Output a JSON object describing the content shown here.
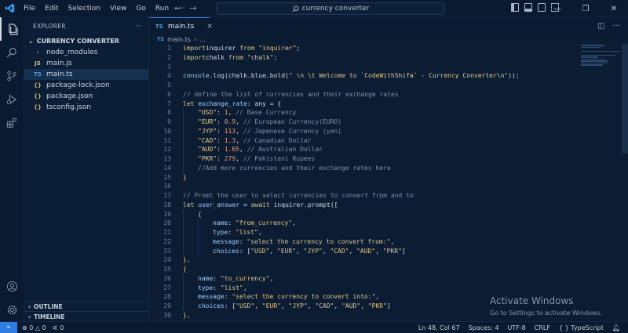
{
  "menu": [
    "File",
    "Edit",
    "Selection",
    "View",
    "Go",
    "Run",
    "···"
  ],
  "search": {
    "text": "currency converter"
  },
  "sidebar": {
    "title": "EXPLORER",
    "more": "···",
    "folder": "CURRENCY CONVERTER",
    "items": [
      {
        "label": "node_modules",
        "icon": "›",
        "icon_name": "folder-chevron-icon"
      },
      {
        "label": "main.js",
        "icon": "JS",
        "icon_name": "javascript-file-icon"
      },
      {
        "label": "main.ts",
        "icon": "TS",
        "icon_name": "typescript-file-icon"
      },
      {
        "label": "package-lock.json",
        "icon": "{}",
        "icon_name": "json-file-icon"
      },
      {
        "label": "package.json",
        "icon": "{}",
        "icon_name": "json-file-icon"
      },
      {
        "label": "tsconfig.json",
        "icon": "{}",
        "icon_name": "json-file-icon"
      }
    ],
    "outline": "OUTLINE",
    "timeline": "TIMELINE"
  },
  "tab": {
    "badge": "TS",
    "label": "main.ts",
    "close": "×"
  },
  "breadcrumb": {
    "badge": "TS",
    "file": "main.ts",
    "sep": "›",
    "rest": "..."
  },
  "code": [
    {
      "n": "1",
      "indent": 0,
      "t": [
        [
          "kw",
          "import"
        ],
        [
          "",
          "inquirer "
        ],
        [
          "kw",
          "from"
        ],
        [
          "str",
          " \"inquirer\""
        ],
        [
          "",
          ";"
        ]
      ]
    },
    {
      "n": "2",
      "indent": 0,
      "t": [
        [
          "kw",
          "import"
        ],
        [
          "",
          "chalk "
        ],
        [
          "kw",
          "from"
        ],
        [
          "str",
          " \"chalk\""
        ],
        [
          "",
          ";"
        ]
      ]
    },
    {
      "n": "3",
      "indent": 0,
      "t": []
    },
    {
      "n": "4",
      "indent": 0,
      "t": [
        [
          "id",
          "console"
        ],
        [
          "",
          ".log(chalk.blue.bold("
        ],
        [
          "str",
          "\" \\n \\t Welcome to `CodeWithShifa` - Currency Converter\\n\""
        ],
        [
          "",
          "));"
        ]
      ]
    },
    {
      "n": "5",
      "indent": 0,
      "t": []
    },
    {
      "n": "6",
      "indent": 0,
      "t": [
        [
          "cm",
          "// define the list of currencies and their exchange rates"
        ]
      ]
    },
    {
      "n": "7",
      "indent": 0,
      "t": [
        [
          "kw",
          "let"
        ],
        [
          "id",
          " exchange_rate"
        ],
        [
          "",
          ": any = {"
        ]
      ]
    },
    {
      "n": "8",
      "indent": 1,
      "t": [
        [
          "str",
          "\"USD\""
        ],
        [
          "",
          ": "
        ],
        [
          "num",
          "1"
        ],
        [
          "",
          ", "
        ],
        [
          "cm",
          "// Base Currency"
        ]
      ]
    },
    {
      "n": "9",
      "indent": 1,
      "t": [
        [
          "str",
          "\"EUR\""
        ],
        [
          "",
          ": "
        ],
        [
          "num",
          "0.9"
        ],
        [
          "",
          ", "
        ],
        [
          "cm",
          "// European Currency(EURO)"
        ]
      ]
    },
    {
      "n": "10",
      "indent": 1,
      "t": [
        [
          "str",
          "\"JYP\""
        ],
        [
          "",
          ": "
        ],
        [
          "num",
          "113"
        ],
        [
          "",
          ", "
        ],
        [
          "cm",
          "// Japenese Currency (yen)"
        ]
      ]
    },
    {
      "n": "11",
      "indent": 1,
      "t": [
        [
          "str",
          "\"CAD\""
        ],
        [
          "",
          ": "
        ],
        [
          "num",
          "1.3"
        ],
        [
          "",
          ", "
        ],
        [
          "cm",
          "// Canadian Dollar"
        ]
      ]
    },
    {
      "n": "12",
      "indent": 1,
      "t": [
        [
          "str",
          "\"AUD\""
        ],
        [
          "",
          ": "
        ],
        [
          "num",
          "1.65"
        ],
        [
          "",
          ", "
        ],
        [
          "cm",
          "// Australian Dollar"
        ]
      ]
    },
    {
      "n": "13",
      "indent": 1,
      "t": [
        [
          "str",
          "\"PKR\""
        ],
        [
          "",
          ": "
        ],
        [
          "num",
          "279"
        ],
        [
          "",
          ", "
        ],
        [
          "cm",
          "// Pakistani Rupees"
        ]
      ]
    },
    {
      "n": "14",
      "indent": 1,
      "t": [
        [
          "cm",
          "//Add more currencies and their exchange rates here"
        ]
      ]
    },
    {
      "n": "15",
      "indent": 0,
      "t": [
        [
          "kw",
          "}"
        ]
      ]
    },
    {
      "n": "16",
      "indent": 0,
      "t": []
    },
    {
      "n": "17",
      "indent": 0,
      "t": [
        [
          "cm",
          "// Promt the user to select currencies to convert frpm and to"
        ]
      ]
    },
    {
      "n": "18",
      "indent": 0,
      "t": [
        [
          "kw",
          "let"
        ],
        [
          "id",
          " user_answer"
        ],
        [
          "",
          " = "
        ],
        [
          "kw",
          "await"
        ],
        [
          "",
          " inquirer.prompt(["
        ]
      ]
    },
    {
      "n": "19",
      "indent": 1,
      "t": [
        [
          "kw",
          "{"
        ]
      ]
    },
    {
      "n": "20",
      "indent": 2,
      "t": [
        [
          "id",
          "name"
        ],
        [
          "",
          ": "
        ],
        [
          "str",
          "\"from_currency\""
        ],
        [
          "",
          ","
        ]
      ]
    },
    {
      "n": "21",
      "indent": 2,
      "t": [
        [
          "id",
          "type"
        ],
        [
          "",
          ": "
        ],
        [
          "str",
          "\"list\""
        ],
        [
          "",
          ","
        ]
      ]
    },
    {
      "n": "22",
      "indent": 2,
      "t": [
        [
          "id",
          "message"
        ],
        [
          "",
          ": "
        ],
        [
          "str",
          "\"select the currency to convert from:\""
        ],
        [
          "",
          ","
        ]
      ]
    },
    {
      "n": "23",
      "indent": 2,
      "t": [
        [
          "id",
          "choices"
        ],
        [
          "",
          ": ["
        ],
        [
          "str",
          "\"USD\""
        ],
        [
          "",
          ", "
        ],
        [
          "str",
          "\"EUR\""
        ],
        [
          "",
          ", "
        ],
        [
          "str",
          "\"JYP\""
        ],
        [
          "",
          ", "
        ],
        [
          "str",
          "\"CAD\""
        ],
        [
          "",
          ", "
        ],
        [
          "str",
          "\"AUD\""
        ],
        [
          "",
          ", "
        ],
        [
          "str",
          "\"PKR\""
        ],
        [
          "",
          "]"
        ]
      ]
    },
    {
      "n": "24",
      "indent": 0,
      "t": [
        [
          "kw",
          "},"
        ]
      ]
    },
    {
      "n": "25",
      "indent": 0,
      "t": [
        [
          "kw",
          "{"
        ]
      ]
    },
    {
      "n": "26",
      "indent": 1,
      "t": [
        [
          "id",
          "name"
        ],
        [
          "",
          ": "
        ],
        [
          "str",
          "\"to_currency\""
        ],
        [
          "",
          ","
        ]
      ]
    },
    {
      "n": "27",
      "indent": 1,
      "t": [
        [
          "id",
          "type"
        ],
        [
          "",
          ": "
        ],
        [
          "str",
          "\"list\""
        ],
        [
          "",
          ","
        ]
      ]
    },
    {
      "n": "28",
      "indent": 1,
      "t": [
        [
          "id",
          "message"
        ],
        [
          "",
          ": "
        ],
        [
          "str",
          "\"select the currency to convert into:\""
        ],
        [
          "",
          ","
        ]
      ]
    },
    {
      "n": "29",
      "indent": 1,
      "t": [
        [
          "id",
          "choices"
        ],
        [
          "",
          ": ["
        ],
        [
          "str",
          "\"USD\""
        ],
        [
          "",
          ", "
        ],
        [
          "str",
          "\"EUR\""
        ],
        [
          "",
          ", "
        ],
        [
          "str",
          "\"JYP\""
        ],
        [
          "",
          ", "
        ],
        [
          "str",
          "\"CAD\""
        ],
        [
          "",
          ", "
        ],
        [
          "str",
          "\"AUD\""
        ],
        [
          "",
          ", "
        ],
        [
          "str",
          "\"PKR\""
        ],
        [
          "",
          "]"
        ]
      ]
    },
    {
      "n": "30",
      "indent": 0,
      "t": [
        [
          "kw",
          "},"
        ]
      ]
    }
  ],
  "watermark": {
    "title": "Activate Windows",
    "subtitle": "Go to Settings to activate Windows."
  },
  "status": {
    "errors": "0",
    "warnings": "0",
    "ports": "0",
    "position": "Ln 48, Col 67",
    "spaces": "Spaces: 4",
    "encoding": "UTF-8",
    "eol": "CRLF",
    "language": "TypeScript"
  }
}
